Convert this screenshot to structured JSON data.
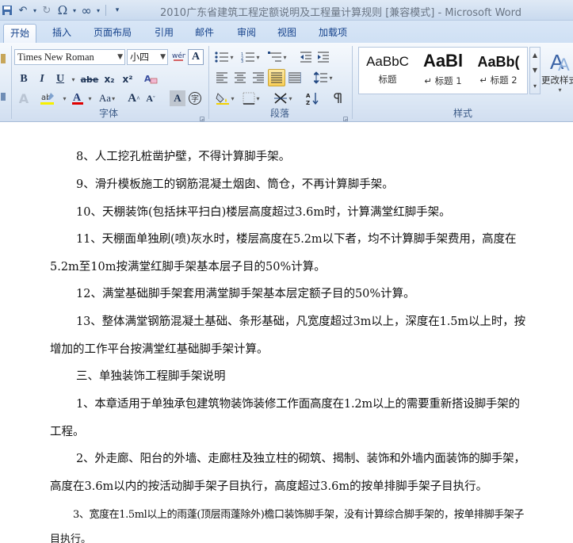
{
  "window": {
    "title": "2010广东省建筑工程定额说明及工程量计算规则 [兼容模式] - Microsoft Word"
  },
  "qat": {
    "save_icon": "save-icon",
    "undo_icon": "undo-icon",
    "redo_icon": "redo-icon",
    "omega_icon": "omega-icon",
    "infinity_icon": "infinity-icon"
  },
  "tabs": [
    {
      "label": "开始",
      "active": true
    },
    {
      "label": "插入"
    },
    {
      "label": "页面布局"
    },
    {
      "label": "引用"
    },
    {
      "label": "邮件"
    },
    {
      "label": "审阅"
    },
    {
      "label": "视图"
    },
    {
      "label": "加载项"
    }
  ],
  "font_group": {
    "label": "字体",
    "font_name": "Times New Roman",
    "font_size": "小四",
    "bold": "B",
    "italic": "I",
    "underline": "U",
    "strike": "abe",
    "subscript": "x₂",
    "superscript": "x²",
    "grow": "A",
    "shrink": "A",
    "case": "Aa",
    "char_border": "A",
    "phonetic": "文"
  },
  "paragraph_group": {
    "label": "段落"
  },
  "styles_group": {
    "label": "样式",
    "items": [
      {
        "sample": "AaBbC",
        "name": "标题"
      },
      {
        "sample": "AaBl",
        "name": "↵ 标题 1"
      },
      {
        "sample": "AaBb(",
        "name": "↵ 标题 2"
      }
    ],
    "change_styles": "更改样式"
  },
  "document": {
    "lines": [
      "8、人工挖孔桩凿护壁，不得计算脚手架。",
      "9、滑升模板施工的钢筋混凝土烟囱、筒仓，不再计算脚手架。",
      "10、天棚装饰(包括抹平扫白)楼层高度超过3.6m时，计算满堂红脚手架。",
      "11、天棚面单独刷(喷)灰水时，楼层高度在5.2m以下者，均不计算脚手架费用，高度在",
      "5.2m至10m按满堂红脚手架基本层子目的50%计算。",
      "12、满堂基础脚手架套用满堂脚手架基本层定额子目的50%计算。",
      "13、整体满堂钢筋混凝土基础、条形基础，凡宽度超过3m以上，深度在1.5m以上时，按",
      "增加的工作平台按满堂红基础脚手架计算。",
      "三、单独装饰工程脚手架说明",
      "1、本章适用于单独承包建筑物装饰装修工作面高度在1.2m以上的需要重新搭设脚手架的",
      "工程。",
      "2、外走廊、阳台的外墙、走廊柱及独立柱的砌筑、揭制、装饰和外墙内面装饰的脚手架，",
      "高度在3.6m以内的按活动脚手架子目执行，高度超过3.6m的按单排脚手架子目执行。",
      "3、宽度在1.5ml以上的雨蓬(顶层雨蓬除外)檐口装饰脚手架，没有计算综合脚手架的，按单排脚手架子",
      "目执行。"
    ]
  }
}
